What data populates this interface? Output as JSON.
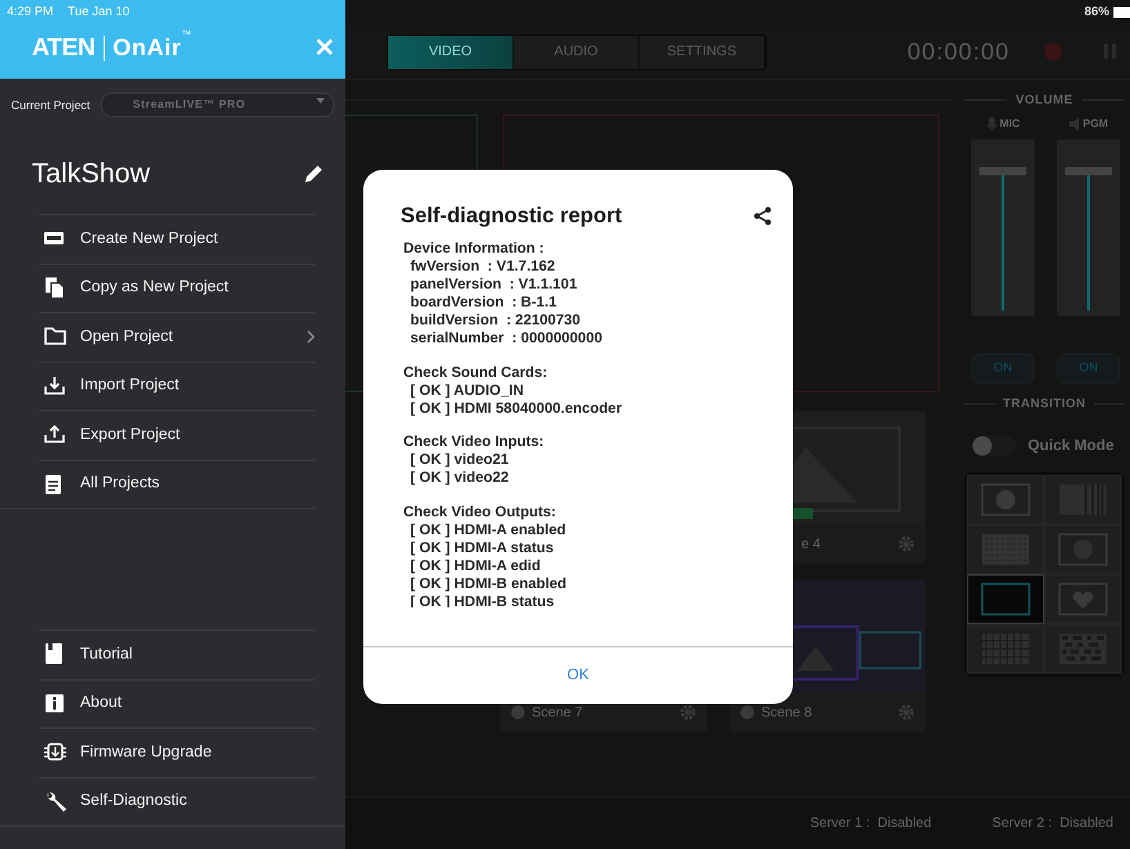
{
  "status_bar": {
    "time": "4:29 PM",
    "date": "Tue Jan 10",
    "battery": "86%"
  },
  "sidebar": {
    "brand": "ATEN",
    "product": "OnAir",
    "product_mark": "™",
    "current_project_label": "Current Project",
    "current_project_value": "StreamLIVE™ PRO",
    "project_name": "TalkShow",
    "items": [
      {
        "label": "Create New Project",
        "kind": "new",
        "submenu": false
      },
      {
        "label": "Copy as New Project",
        "kind": "copy",
        "submenu": false
      },
      {
        "label": "Open Project",
        "kind": "folder",
        "submenu": true
      },
      {
        "label": "Import Project",
        "kind": "import",
        "submenu": false
      },
      {
        "label": "Export Project",
        "kind": "export",
        "submenu": false
      },
      {
        "label": "All Projects",
        "kind": "clipboard",
        "submenu": false
      }
    ],
    "footer_items": [
      {
        "label": "Tutorial",
        "kind": "book"
      },
      {
        "label": "About",
        "kind": "info"
      },
      {
        "label": "Firmware Upgrade",
        "kind": "chip"
      },
      {
        "label": "Self-Diagnostic",
        "kind": "wrench"
      }
    ]
  },
  "main": {
    "tabs": [
      {
        "label": "VIDEO",
        "selected": true
      },
      {
        "label": "AUDIO",
        "selected": false
      },
      {
        "label": "SETTINGS",
        "selected": false
      }
    ],
    "timer": "00:00:00",
    "volume": {
      "title": "VOLUME",
      "channels": [
        {
          "label": "MIC",
          "kind": "mic",
          "level": 0.85,
          "button": "ON"
        },
        {
          "label": "PGM",
          "kind": "speaker",
          "level": 0.85,
          "button": "ON"
        }
      ]
    },
    "transition": {
      "title": "TRANSITION",
      "quick_mode": {
        "label": "Quick Mode",
        "on": false
      },
      "effects": [
        {
          "kind": "circle",
          "selected": false
        },
        {
          "kind": "bars",
          "selected": false
        },
        {
          "kind": "dots",
          "selected": false
        },
        {
          "kind": "glow",
          "selected": false
        },
        {
          "kind": "rect",
          "selected": true
        },
        {
          "kind": "heart",
          "selected": false
        },
        {
          "kind": "grid",
          "selected": false
        },
        {
          "kind": "checker",
          "selected": false
        }
      ]
    },
    "scenes": [
      {
        "label": "e 4",
        "badge": false
      },
      {
        "label": "Scene 7",
        "badge": true
      },
      {
        "label": "Scene 8",
        "badge": true
      }
    ],
    "servers": [
      {
        "label": "Server 1 :",
        "value": "Disabled"
      },
      {
        "label": "Server 2 :",
        "value": "Disabled"
      }
    ]
  },
  "dialog": {
    "title": "Self-diagnostic report",
    "sections": [
      {
        "heading": "Device Information :",
        "lines": [
          "fwVersion  : V1.7.162",
          "panelVersion  : V1.1.101",
          "boardVersion  : B-1.1",
          "buildVersion  : 22100730",
          "serialNumber  : 0000000000"
        ]
      },
      {
        "heading": "Check Sound Cards:",
        "lines": [
          "[ OK ] AUDIO_IN",
          "[ OK ] HDMI 58040000.encoder"
        ]
      },
      {
        "heading": "Check Video Inputs:",
        "lines": [
          "[ OK ] video21",
          "[ OK ] video22"
        ]
      },
      {
        "heading": "Check Video Outputs:",
        "lines": [
          "[ OK ] HDMI-A enabled",
          "[ OK ] HDMI-A status",
          "[ OK ] HDMI-A edid",
          "[ OK ] HDMI-B enabled",
          "[ OK ] HDMI-B status"
        ]
      }
    ],
    "button": "OK"
  }
}
